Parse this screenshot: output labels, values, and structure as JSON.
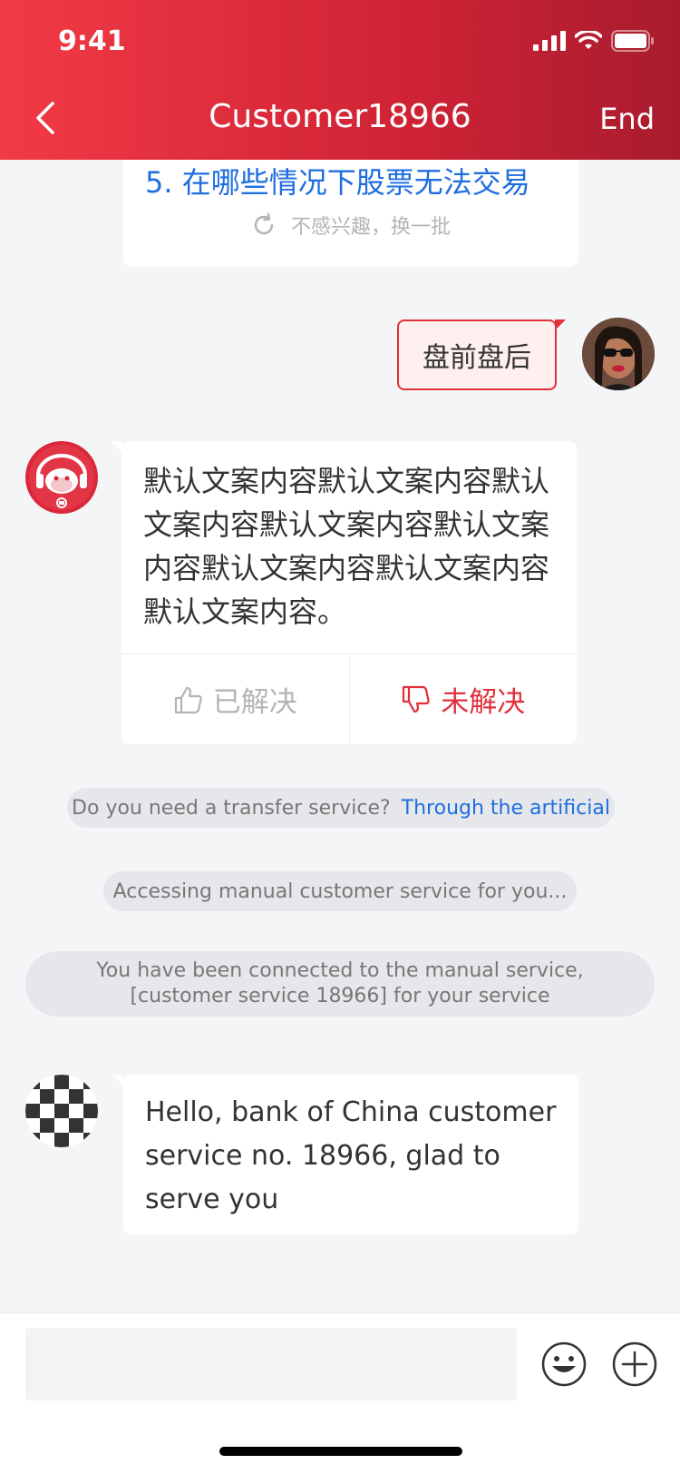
{
  "status_bar": {
    "time": "9:41"
  },
  "nav": {
    "title": "Customer18966",
    "end_label": "End"
  },
  "question_card": {
    "item": "5. 在哪些情况下股票无法交易",
    "refresh_label": "不感兴趣，换一批"
  },
  "user_message": {
    "text": "盘前盘后"
  },
  "bot_message": {
    "text": "默认文案内容默认文案内容默认文案内容默认文案内容默认文案内容默认文案内容默认文案内容默认文案内容。",
    "solved_label": "已解决",
    "unsolved_label": "未解决"
  },
  "system": {
    "transfer_question": "Do you need a transfer service?",
    "transfer_link": "Through the artificial",
    "accessing": "Accessing manual customer service for you...",
    "connected": "You have been connected to the manual service, [customer service 18966] for your service"
  },
  "agent_message": {
    "text": "Hello, bank of China customer service no. 18966, glad to serve you"
  },
  "input_bar": {
    "value": "",
    "placeholder": ""
  },
  "colors": {
    "header_start": "#f23a45",
    "header_end": "#a81c2e",
    "accent_red": "#e0303a",
    "link_blue": "#1e6ee0"
  },
  "icons": [
    "back-chevron-icon",
    "signal-icon",
    "wifi-icon",
    "battery-icon",
    "refresh-icon",
    "thumbs-up-icon",
    "thumbs-down-icon",
    "emoji-icon",
    "plus-icon"
  ]
}
